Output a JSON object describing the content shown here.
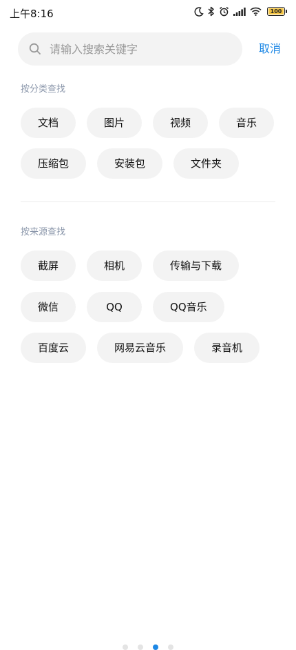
{
  "status_bar": {
    "time": "上午8:16",
    "battery": "100",
    "icons": [
      "moon-icon",
      "bluetooth-icon",
      "alarm-icon",
      "signal-icon",
      "wifi-icon",
      "battery-icon"
    ]
  },
  "search": {
    "placeholder": "请输入搜索关键字",
    "value": "",
    "cancel_label": "取消"
  },
  "by_category": {
    "title": "按分类查找",
    "rows": [
      [
        "文档",
        "图片",
        "视频",
        "音乐"
      ],
      [
        "压缩包",
        "安装包",
        "文件夹"
      ]
    ]
  },
  "by_source": {
    "title": "按来源查找",
    "rows": [
      [
        "截屏",
        "相机",
        "传输与下载"
      ],
      [
        "微信",
        "QQ",
        "QQ音乐"
      ],
      [
        "百度云",
        "网易云音乐",
        "录音机"
      ]
    ]
  },
  "colors": {
    "accent": "#1e88e5",
    "chip_bg": "#f3f3f3",
    "section_title": "#8a96aa"
  }
}
